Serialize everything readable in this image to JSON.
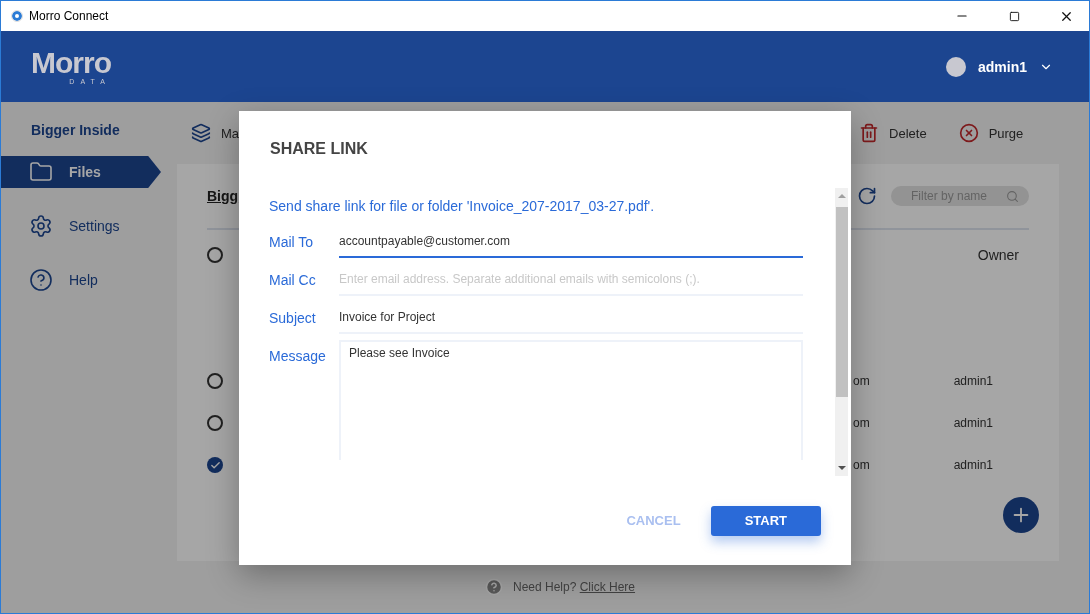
{
  "window": {
    "title": "Morro Connect"
  },
  "header": {
    "logo": "Morro",
    "logo_sub": "DATA",
    "user": "admin1"
  },
  "sidebar": {
    "title": "Bigger Inside",
    "items": [
      {
        "label": "Files",
        "selected": true
      },
      {
        "label": "Settings",
        "selected": false
      },
      {
        "label": "Help",
        "selected": false
      }
    ]
  },
  "toolbar": {
    "items": [
      {
        "label": "Ma"
      },
      {
        "label": "Delete"
      },
      {
        "label": "Purge"
      }
    ]
  },
  "card": {
    "breadcrumb": "Bigg",
    "filter": {
      "placeholder": "Filter by name"
    },
    "header_selected": false,
    "owner_heading": "Owner",
    "rows": [
      {
        "selected": false,
        "column_2": "om",
        "owner": "admin1"
      },
      {
        "selected": false,
        "column_2": "om",
        "owner": "admin1"
      },
      {
        "selected": true,
        "column_2": "om",
        "owner": "admin1"
      }
    ]
  },
  "footer": {
    "text": "Need Help?",
    "link": "Click Here"
  },
  "dialog": {
    "title": "SHARE LINK",
    "description": "Send share link for file or folder 'Invoice_207-2017_03-27.pdf'.",
    "fields": [
      {
        "label": "Mail To",
        "value": "accountpayable@customer.com",
        "focused": true
      },
      {
        "label": "Mail Cc",
        "placeholder": "Enter email address. Separate additional emails with semicolons (;).",
        "focused": false
      },
      {
        "label": "Subject",
        "value": "Invoice for Project",
        "focused": false
      }
    ],
    "message": {
      "label": "Message",
      "value": "Please see Invoice"
    },
    "buttons": [
      {
        "label": "CANCEL",
        "kind": "text"
      },
      {
        "label": "START",
        "kind": "primary"
      }
    ]
  }
}
